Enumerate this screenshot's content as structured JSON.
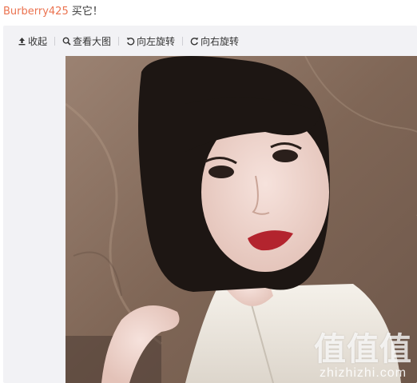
{
  "post": {
    "username": "Burberry425",
    "text": "买它！"
  },
  "toolbar": {
    "collapse_label": "收起",
    "view_large_label": "查看大图",
    "rotate_left_label": "向左旋转",
    "rotate_right_label": "向右旋转"
  },
  "photo": {
    "watermark_logo": "值值值",
    "watermark_url": "zhizhizhi.com"
  },
  "colors": {
    "username": "#eb7350",
    "toolbar_bg": "#f2f2f5"
  },
  "icons": [
    "collapse-icon",
    "magnifier-icon",
    "rotate-left-icon",
    "rotate-right-icon"
  ]
}
